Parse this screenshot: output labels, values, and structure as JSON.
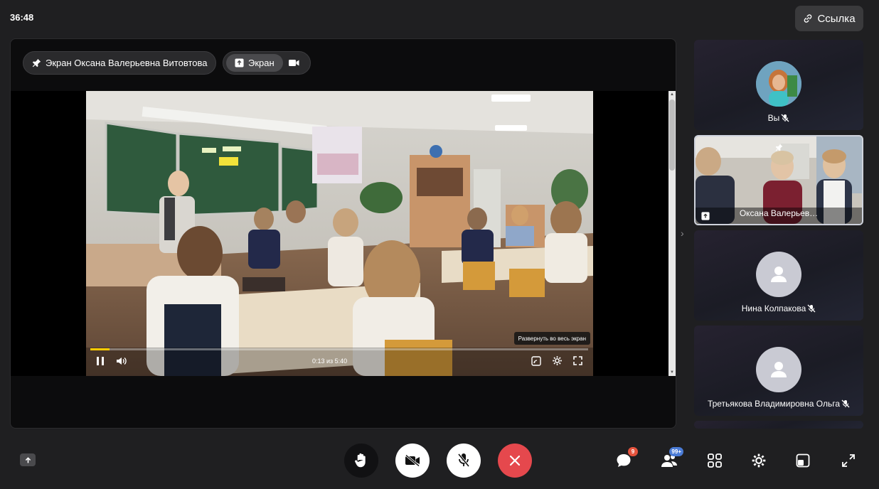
{
  "header": {
    "timer": "36:48",
    "link_button_label": "Ссылка"
  },
  "stage": {
    "pinned_label": "Экран Оксана Валерьевна Витовтова",
    "source_toggle": {
      "screen_label": "Экран"
    },
    "video": {
      "time": "0:13 из 5:40",
      "progress": 0.038,
      "tooltip": "Развернуть во весь экран"
    }
  },
  "participants": [
    {
      "label": "Вы",
      "muted": true
    },
    {
      "label": "Оксана Валерьев…",
      "pinned": true,
      "sharing": true
    },
    {
      "label": "Нина Колпакова",
      "muted": true
    },
    {
      "label": "Третьякова Владимировна Ольга",
      "muted": true
    }
  ],
  "toolbar": {
    "chat_badge": "9",
    "participants_badge": "99+",
    "colors": {
      "end_call": "#e5484d",
      "accent_badge": "#4a7bd6",
      "chat_badge": "#e5533d"
    }
  }
}
